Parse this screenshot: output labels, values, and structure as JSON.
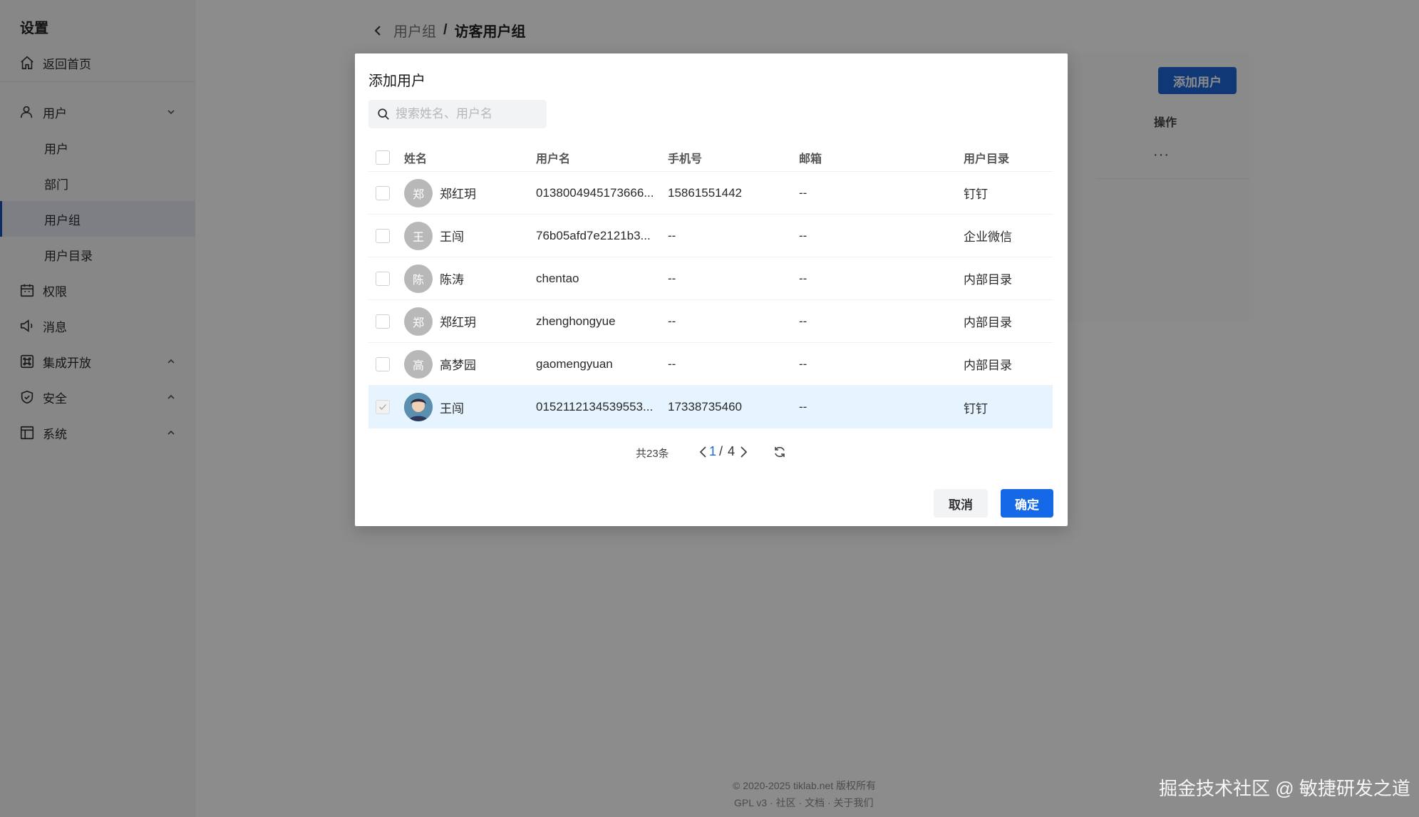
{
  "sidebar": {
    "title": "设置",
    "home": "返回首页",
    "user_group": "用户",
    "subitems": [
      "用户",
      "部门",
      "用户组",
      "用户目录"
    ],
    "items": [
      "权限",
      "消息",
      "集成开放",
      "安全",
      "系统"
    ]
  },
  "breadcrumb": {
    "parent": "用户组",
    "separator": "/",
    "current": "访客用户组"
  },
  "page": {
    "add_user_button": "添加用户",
    "operation_header": "操作",
    "more": "···",
    "footer_line1": "© 2020-2025 tiklab.net 版权所有",
    "footer_line2": "GPL v3 · 社区 · 文档 · 关于我们"
  },
  "watermark": "掘金技术社区 @ 敏捷研发之道",
  "modal": {
    "title": "添加用户",
    "search_placeholder": "搜索姓名、用户名",
    "columns": {
      "name": "姓名",
      "username": "用户名",
      "phone": "手机号",
      "email": "邮箱",
      "directory": "用户目录"
    },
    "rows": [
      {
        "avatar": "郑",
        "name": "郑红玥",
        "username": "0138004945173666...",
        "phone": "15861551442",
        "email": "--",
        "directory": "钉钉",
        "checked": false
      },
      {
        "avatar": "王",
        "name": "王闯",
        "username": "76b05afd7e2121b3...",
        "phone": "--",
        "email": "--",
        "directory": "企业微信",
        "checked": false
      },
      {
        "avatar": "陈",
        "name": "陈涛",
        "username": "chentao",
        "phone": "--",
        "email": "--",
        "directory": "内部目录",
        "checked": false
      },
      {
        "avatar": "郑",
        "name": "郑红玥",
        "username": "zhenghongyue",
        "phone": "--",
        "email": "--",
        "directory": "内部目录",
        "checked": false
      },
      {
        "avatar": "高",
        "name": "高梦园",
        "username": "gaomengyuan",
        "phone": "--",
        "email": "--",
        "directory": "内部目录",
        "checked": false
      },
      {
        "avatar": "",
        "name": "王闯",
        "username": "0152112134539553...",
        "phone": "17338735460",
        "email": "--",
        "directory": "钉钉",
        "checked": true
      }
    ],
    "pagination": {
      "total_text": "共23条",
      "current": "1",
      "separator": "/",
      "total_pages": "4"
    },
    "cancel": "取消",
    "confirm": "确定"
  },
  "colors": {
    "primary": "#1669e6",
    "active_sidebar": "#1d4fb8",
    "selected_row": "#e6f4ff"
  }
}
